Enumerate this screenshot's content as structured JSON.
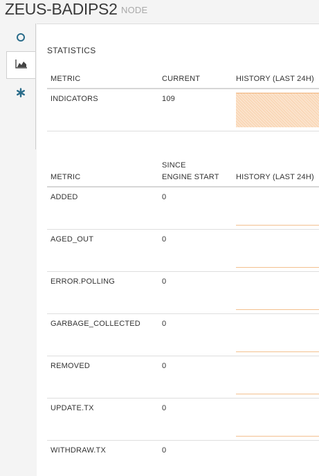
{
  "header": {
    "title": "ZEUS-BADIPS2",
    "subtitle": "NODE"
  },
  "nav": [
    {
      "icon": "circle-outline-icon",
      "active": false
    },
    {
      "icon": "area-chart-icon",
      "active": true
    },
    {
      "icon": "asterisk-icon",
      "active": false
    }
  ],
  "statistics": {
    "title": "STATISTICS",
    "columns": {
      "metric": "METRIC",
      "current": "CURRENT",
      "history": "HISTORY (LAST 24H)"
    },
    "rows": [
      {
        "metric": "INDICATORS",
        "current": "109"
      }
    ]
  },
  "metrics": {
    "columns": {
      "metric": "METRIC",
      "since_line1": "SINCE",
      "since_line2": "ENGINE START",
      "history": "HISTORY (LAST 24H)"
    },
    "rows": [
      {
        "metric": "ADDED",
        "value": "0"
      },
      {
        "metric": "AGED_OUT",
        "value": "0"
      },
      {
        "metric": "ERROR.POLLING",
        "value": "0"
      },
      {
        "metric": "GARBAGE_COLLECTED",
        "value": "0"
      },
      {
        "metric": "REMOVED",
        "value": "0"
      },
      {
        "metric": "UPDATE.TX",
        "value": "0"
      },
      {
        "metric": "WITHDRAW.TX",
        "value": "0"
      }
    ]
  },
  "colors": {
    "accent": "#2a6c8a",
    "spark_fill": "#fbe3cc",
    "spark_line": "#f3c08e"
  }
}
